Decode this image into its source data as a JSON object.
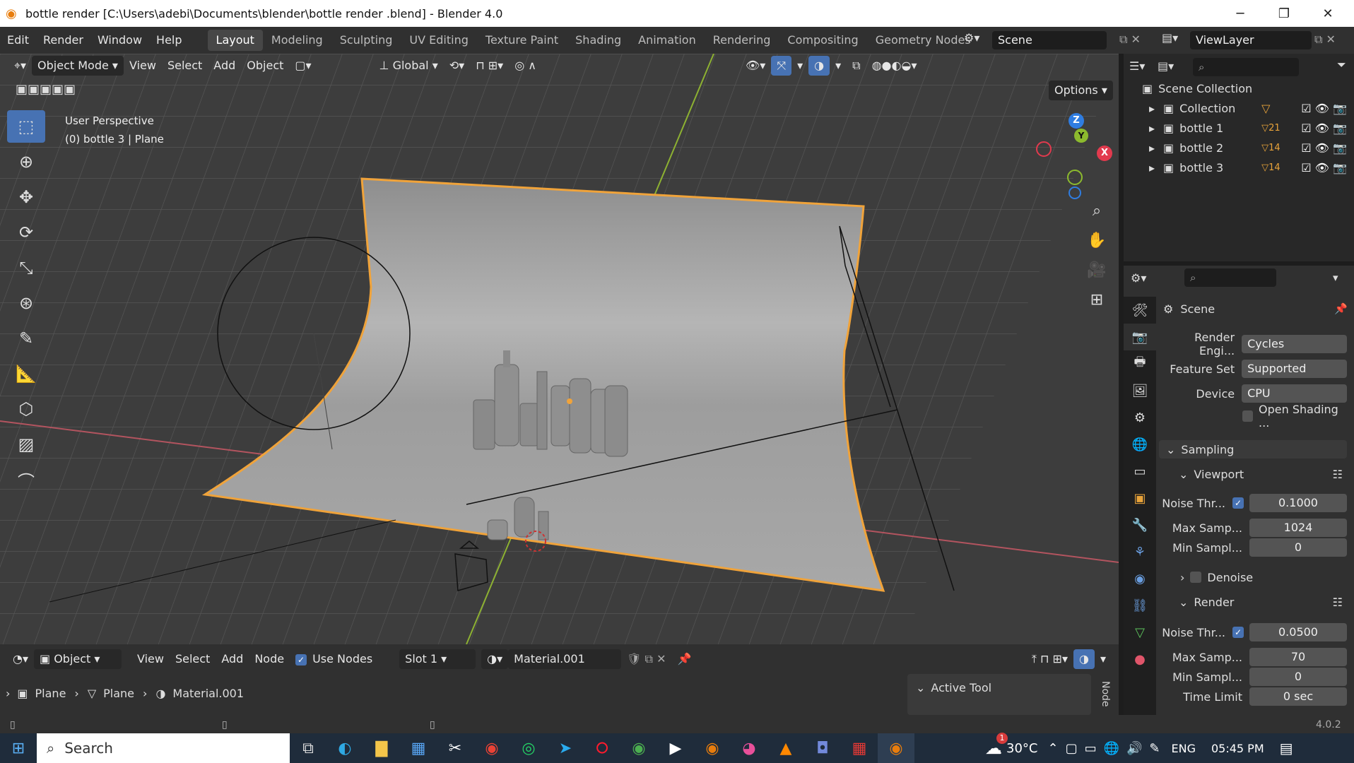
{
  "window": {
    "title": "bottle render  [C:\\Users\\adebi\\Documents\\blender\\bottle render .blend] - Blender 4.0",
    "minimize": "─",
    "restore": "❐",
    "close": "✕"
  },
  "menu": [
    "Edit",
    "Render",
    "Window",
    "Help"
  ],
  "workspaces": [
    "Layout",
    "Modeling",
    "Sculpting",
    "UV Editing",
    "Texture Paint",
    "Shading",
    "Animation",
    "Rendering",
    "Compositing",
    "Geometry Nodes"
  ],
  "active_workspace": "Layout",
  "scene": "Scene",
  "view_layer": "ViewLayer",
  "viewport": {
    "mode": "Object Mode",
    "menus": [
      "View",
      "Select",
      "Add",
      "Object"
    ],
    "transform": "Global",
    "options": "Options",
    "perspective": "User Perspective",
    "selection": "(0) bottle 3  | Plane"
  },
  "gizmo": {
    "z": "Z",
    "y": "Y",
    "x": "X"
  },
  "outliner": {
    "root": "Scene Collection",
    "items": [
      {
        "name": "Collection",
        "badge": ""
      },
      {
        "name": "bottle 1",
        "badge": "21"
      },
      {
        "name": "bottle 2",
        "badge": "14"
      },
      {
        "name": "bottle 3",
        "badge": "14"
      }
    ]
  },
  "properties": {
    "header": "Scene",
    "render_engine_label": "Render Engi...",
    "render_engine": "Cycles",
    "feature_set_label": "Feature Set",
    "feature_set": "Supported",
    "device_label": "Device",
    "device": "CPU",
    "open_shading": "Open Shading ...",
    "sampling": "Sampling",
    "viewport_section": "Viewport",
    "vp_noise_label": "Noise Thr...",
    "vp_noise": "0.1000",
    "vp_max_label": "Max Samp...",
    "vp_max": "1024",
    "vp_min_label": "Min Sampl...",
    "vp_min": "0",
    "denoise": "Denoise",
    "render_section": "Render",
    "r_noise_label": "Noise Thr...",
    "r_noise": "0.0500",
    "r_max_label": "Max Samp...",
    "r_max": "70",
    "r_min_label": "Min Sampl...",
    "r_min": "0",
    "time_limit_label": "Time Limit",
    "time_limit": "0 sec"
  },
  "shader": {
    "type": "Object",
    "menus": [
      "View",
      "Select",
      "Add",
      "Node"
    ],
    "use_nodes": "Use Nodes",
    "slot": "Slot 1",
    "material": "Material.001",
    "breadcrumb": [
      "Plane",
      "Plane",
      "Material.001"
    ],
    "active_tool": "Active Tool",
    "node_tab": "Node"
  },
  "status": {
    "version": "4.0.2"
  },
  "taskbar": {
    "search": "Search",
    "weather": "30°C",
    "weather_badge": "1",
    "lang": "ENG",
    "time": "05:45 PM"
  }
}
